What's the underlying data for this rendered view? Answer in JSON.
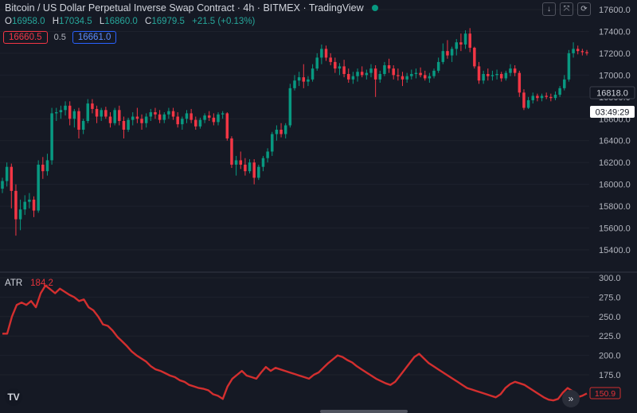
{
  "window": {
    "title": "Bitcoin / US Dollar Perpetual Inverse Swap Contract · 4h · BITMEX · TradingView"
  },
  "ohlc": {
    "o_label": "O",
    "o": "16958.0",
    "h_label": "H",
    "h": "17034.5",
    "l_label": "L",
    "l": "16860.0",
    "c_label": "C",
    "c": "16979.5",
    "change": "+21.5 (+0.13%)"
  },
  "trade": {
    "sell": "16660.5",
    "spread": "0.5",
    "buy": "16661.0"
  },
  "controls": {
    "down": "↓",
    "fullscreen": "⤧",
    "refresh": "⟳"
  },
  "price_axis": {
    "ticks": [
      "17600.0",
      "17400.0",
      "17200.0",
      "17000.0",
      "16800.0",
      "16600.0",
      "16400.0",
      "16200.0",
      "16000.0",
      "15800.0",
      "15600.0",
      "15400.0"
    ],
    "last_price_label": "16818.0",
    "countdown_label": "03:49:29"
  },
  "atr": {
    "name": "ATR",
    "legend_value": "184.2",
    "axis_ticks": [
      "300.0",
      "275.0",
      "250.0",
      "225.0",
      "200.0",
      "175.0"
    ],
    "last_label": "150.9"
  },
  "brand": {
    "logo_text": "TV"
  },
  "nav": {
    "scroll_icon": "»"
  },
  "colors": {
    "up": "#089981",
    "down": "#f23645",
    "atr_line": "#d32f2f",
    "background": "#151924"
  },
  "chart_data": [
    {
      "type": "candlestick",
      "ylim": [
        15300,
        17700
      ],
      "y_ticks": [
        17600,
        17400,
        17200,
        17000,
        16800,
        16600,
        16400,
        16200,
        16000,
        15800,
        15600,
        15400
      ],
      "candles": [
        [
          15960,
          16060,
          15920,
          16030
        ],
        [
          16030,
          16200,
          15980,
          16160
        ],
        [
          16160,
          16190,
          15780,
          15940
        ],
        [
          15940,
          16000,
          15530,
          15680
        ],
        [
          15680,
          15860,
          15580,
          15770
        ],
        [
          15770,
          15900,
          15720,
          15840
        ],
        [
          15840,
          15920,
          15780,
          15860
        ],
        [
          15860,
          15890,
          15700,
          15760
        ],
        [
          15760,
          16220,
          15740,
          16180
        ],
        [
          16180,
          16250,
          16050,
          16120
        ],
        [
          16120,
          16280,
          16080,
          16220
        ],
        [
          16220,
          16700,
          16180,
          16650
        ],
        [
          16650,
          16700,
          16580,
          16660
        ],
        [
          16660,
          16720,
          16600,
          16680
        ],
        [
          16680,
          16760,
          16630,
          16720
        ],
        [
          16720,
          16760,
          16540,
          16600
        ],
        [
          16600,
          16690,
          16520,
          16670
        ],
        [
          16670,
          16700,
          16420,
          16500
        ],
        [
          16500,
          16600,
          16460,
          16580
        ],
        [
          16580,
          16780,
          16560,
          16740
        ],
        [
          16740,
          16780,
          16650,
          16690
        ],
        [
          16690,
          16720,
          16560,
          16620
        ],
        [
          16620,
          16700,
          16580,
          16680
        ],
        [
          16680,
          16710,
          16600,
          16620
        ],
        [
          16620,
          16660,
          16520,
          16560
        ],
        [
          16560,
          16700,
          16540,
          16680
        ],
        [
          16680,
          16720,
          16540,
          16580
        ],
        [
          16580,
          16620,
          16420,
          16500
        ],
        [
          16500,
          16610,
          16480,
          16590
        ],
        [
          16590,
          16660,
          16540,
          16620
        ],
        [
          16620,
          16700,
          16560,
          16600
        ],
        [
          16600,
          16640,
          16500,
          16560
        ],
        [
          16560,
          16650,
          16520,
          16620
        ],
        [
          16620,
          16690,
          16580,
          16660
        ],
        [
          16660,
          16700,
          16600,
          16640
        ],
        [
          16640,
          16680,
          16560,
          16590
        ],
        [
          16590,
          16660,
          16560,
          16640
        ],
        [
          16640,
          16700,
          16600,
          16670
        ],
        [
          16670,
          16700,
          16590,
          16620
        ],
        [
          16620,
          16660,
          16520,
          16550
        ],
        [
          16550,
          16620,
          16500,
          16600
        ],
        [
          16600,
          16680,
          16560,
          16650
        ],
        [
          16650,
          16690,
          16560,
          16590
        ],
        [
          16590,
          16620,
          16500,
          16530
        ],
        [
          16530,
          16610,
          16510,
          16590
        ],
        [
          16590,
          16650,
          16560,
          16630
        ],
        [
          16630,
          16670,
          16580,
          16610
        ],
        [
          16610,
          16650,
          16540,
          16570
        ],
        [
          16570,
          16660,
          16540,
          16640
        ],
        [
          16640,
          16670,
          16600,
          16650
        ],
        [
          16650,
          16660,
          16400,
          16420
        ],
        [
          16420,
          16440,
          16150,
          16180
        ],
        [
          16180,
          16260,
          16080,
          16220
        ],
        [
          16220,
          16300,
          16140,
          16180
        ],
        [
          16180,
          16240,
          16080,
          16120
        ],
        [
          16120,
          16230,
          16100,
          16200
        ],
        [
          16200,
          16230,
          16000,
          16060
        ],
        [
          16060,
          16180,
          16040,
          16160
        ],
        [
          16160,
          16260,
          16120,
          16240
        ],
        [
          16240,
          16330,
          16200,
          16300
        ],
        [
          16300,
          16480,
          16260,
          16460
        ],
        [
          16460,
          16540,
          16400,
          16500
        ],
        [
          16500,
          16560,
          16430,
          16460
        ],
        [
          16460,
          16560,
          16420,
          16540
        ],
        [
          16540,
          16920,
          16520,
          16880
        ],
        [
          16880,
          17000,
          16860,
          16950
        ],
        [
          16950,
          17030,
          16900,
          16980
        ],
        [
          16980,
          17100,
          16880,
          16940
        ],
        [
          16940,
          16990,
          16900,
          16960
        ],
        [
          16960,
          17100,
          16940,
          17060
        ],
        [
          17060,
          17200,
          17040,
          17160
        ],
        [
          17160,
          17280,
          17100,
          17240
        ],
        [
          17240,
          17270,
          17130,
          17160
        ],
        [
          17160,
          17200,
          17090,
          17120
        ],
        [
          17120,
          17160,
          17020,
          17060
        ],
        [
          17060,
          17110,
          17000,
          17080
        ],
        [
          17080,
          17140,
          16980,
          17010
        ],
        [
          17010,
          17060,
          16930,
          16960
        ],
        [
          16960,
          17030,
          16920,
          16990
        ],
        [
          16990,
          17060,
          16940,
          17030
        ],
        [
          17030,
          17080,
          16980,
          17000
        ],
        [
          17000,
          17050,
          16960,
          17020
        ],
        [
          17020,
          17100,
          16980,
          17060
        ],
        [
          17060,
          17090,
          16800,
          16960
        ],
        [
          16960,
          17040,
          16930,
          17010
        ],
        [
          17010,
          17120,
          16990,
          17090
        ],
        [
          17090,
          17150,
          17020,
          17060
        ],
        [
          17060,
          17090,
          16960,
          17000
        ],
        [
          17000,
          17060,
          16950,
          16990
        ],
        [
          16990,
          17030,
          16900,
          16960
        ],
        [
          16960,
          17020,
          16930,
          16990
        ],
        [
          16990,
          17050,
          16960,
          17010
        ],
        [
          17010,
          17060,
          16970,
          17020
        ],
        [
          17020,
          17070,
          16980,
          17000
        ],
        [
          17000,
          17040,
          16950,
          16970
        ],
        [
          16970,
          17020,
          16930,
          16990
        ],
        [
          16990,
          17060,
          16970,
          17040
        ],
        [
          17040,
          17160,
          17020,
          17120
        ],
        [
          17120,
          17290,
          17100,
          17220
        ],
        [
          17220,
          17320,
          17150,
          17180
        ],
        [
          17180,
          17260,
          17120,
          17240
        ],
        [
          17240,
          17330,
          17180,
          17300
        ],
        [
          17300,
          17380,
          17220,
          17280
        ],
        [
          17280,
          17410,
          17240,
          17380
        ],
        [
          17380,
          17430,
          17210,
          17250
        ],
        [
          17250,
          17260,
          17060,
          17080
        ],
        [
          17080,
          17120,
          16920,
          16950
        ],
        [
          16950,
          17040,
          16920,
          17010
        ],
        [
          17010,
          17060,
          16950,
          16990
        ],
        [
          16990,
          17040,
          16950,
          17000
        ],
        [
          17000,
          17050,
          16960,
          17010
        ],
        [
          17010,
          17030,
          16940,
          16970
        ],
        [
          16970,
          17040,
          16950,
          17020
        ],
        [
          17020,
          17100,
          16990,
          17060
        ],
        [
          17060,
          17090,
          16990,
          17020
        ],
        [
          17020,
          17040,
          16800,
          16840
        ],
        [
          16840,
          16870,
          16680,
          16700
        ],
        [
          16700,
          16800,
          16690,
          16770
        ],
        [
          16770,
          16840,
          16740,
          16810
        ],
        [
          16810,
          16830,
          16760,
          16790
        ],
        [
          16790,
          16830,
          16760,
          16810
        ],
        [
          16810,
          16840,
          16780,
          16800
        ],
        [
          16800,
          16830,
          16760,
          16790
        ],
        [
          16790,
          16850,
          16770,
          16820
        ],
        [
          16820,
          16900,
          16800,
          16880
        ],
        [
          16880,
          17000,
          16860,
          16960
        ],
        [
          16960,
          17230,
          16940,
          17200
        ],
        [
          17200,
          17300,
          17160,
          17240
        ],
        [
          17240,
          17270,
          17190,
          17220
        ],
        [
          17220,
          17240,
          17180,
          17210
        ],
        [
          17210,
          17230,
          17180,
          17200
        ]
      ]
    },
    {
      "type": "line",
      "title": "ATR",
      "ylim": [
        138,
        300
      ],
      "y_ticks": [
        300,
        275,
        250,
        225,
        200,
        175
      ],
      "series": [
        {
          "name": "ATR",
          "values": [
            228,
            228,
            250,
            265,
            268,
            265,
            270,
            262,
            280,
            290,
            285,
            280,
            286,
            282,
            278,
            275,
            270,
            272,
            262,
            258,
            250,
            240,
            238,
            232,
            224,
            218,
            212,
            205,
            200,
            196,
            192,
            186,
            182,
            180,
            177,
            174,
            172,
            168,
            166,
            162,
            160,
            158,
            157,
            155,
            150,
            148,
            144,
            160,
            170,
            175,
            180,
            174,
            172,
            170,
            178,
            185,
            180,
            184,
            182,
            180,
            178,
            176,
            174,
            172,
            170,
            175,
            178,
            184,
            190,
            195,
            200,
            198,
            194,
            191,
            186,
            182,
            178,
            174,
            170,
            167,
            164,
            162,
            166,
            174,
            182,
            190,
            198,
            202,
            196,
            190,
            186,
            182,
            178,
            174,
            170,
            166,
            162,
            158,
            156,
            154,
            152,
            150,
            148,
            146,
            150,
            158,
            163,
            166,
            164,
            162,
            158,
            154,
            150,
            146,
            143,
            142,
            144,
            152,
            158,
            154,
            146,
            148,
            151
          ]
        }
      ]
    }
  ]
}
